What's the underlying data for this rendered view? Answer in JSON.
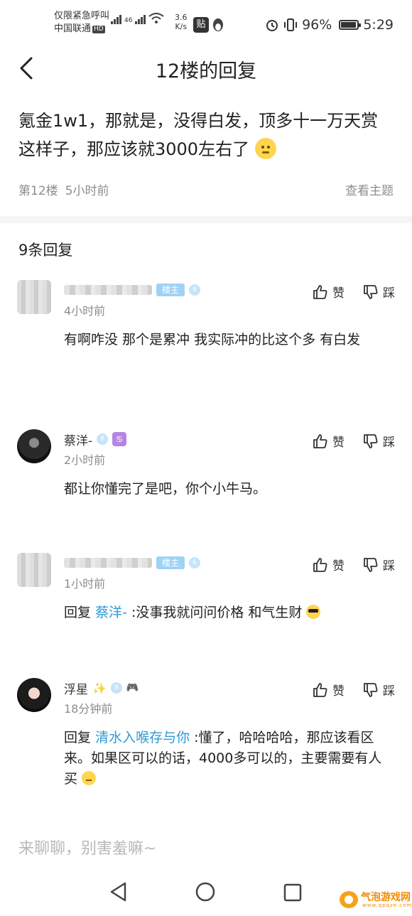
{
  "status_bar": {
    "carrier_line1": "仅限紧急呼叫",
    "carrier_line2": "中国联通",
    "hd": "HD",
    "net_type": "46",
    "speed_value": "3.6",
    "speed_unit": "K/s",
    "app_badge": "贴",
    "battery": "96%",
    "time": "5:29"
  },
  "header": {
    "title": "12楼的回复"
  },
  "post": {
    "text": "氪金1w1，那就是，没得白发，顶多十一万天赏这样子，那应该就3000左右了",
    "floor": "第12楼",
    "time": "5小时前",
    "view_topic": "查看主题"
  },
  "reply_count": "9条回复",
  "replies": [
    {
      "name": "",
      "badge": "楼主",
      "level": "6",
      "time": "4小时前",
      "like": "赞",
      "dislike": "踩",
      "content": "有啊咋没 那个是累冲 我实际冲的比这个多 有白发"
    },
    {
      "name": "蔡洋-",
      "level": "8",
      "zodiac": "♋",
      "time": "2小时前",
      "like": "赞",
      "dislike": "踩",
      "content": "都让你懂完了是吧，你个小牛马。"
    },
    {
      "name": "",
      "badge": "楼主",
      "level": "6",
      "time": "1小时前",
      "like": "赞",
      "dislike": "踩",
      "reply_prefix": "回复",
      "mention": "蔡洋-",
      "content": ":没事我就问问价格 和气生财"
    },
    {
      "name": "浮星",
      "sparkle": "✨",
      "level": "9",
      "gamepad": "🎮",
      "time": "18分钟前",
      "like": "赞",
      "dislike": "踩",
      "reply_prefix": "回复",
      "mention": "清水入喉存与你",
      "content": ":懂了，哈哈哈哈，那应该看区来。如果区可以的话，4000多可以的，主要需要有人买"
    }
  ],
  "comment_input": {
    "placeholder": "来聊聊，别害羞嘛~"
  },
  "watermark": {
    "text": "气泡游戏网",
    "sub": "www.qpqze.com"
  },
  "colors": {
    "mention": "#2e9bd6",
    "host_badge": "#9fd2f5",
    "muted": "#8d8d8d"
  },
  "icons": [
    "back-arrow-icon",
    "thumbs-up-icon",
    "thumbs-down-icon",
    "nav-back-icon",
    "nav-home-icon",
    "nav-recent-icon"
  ]
}
